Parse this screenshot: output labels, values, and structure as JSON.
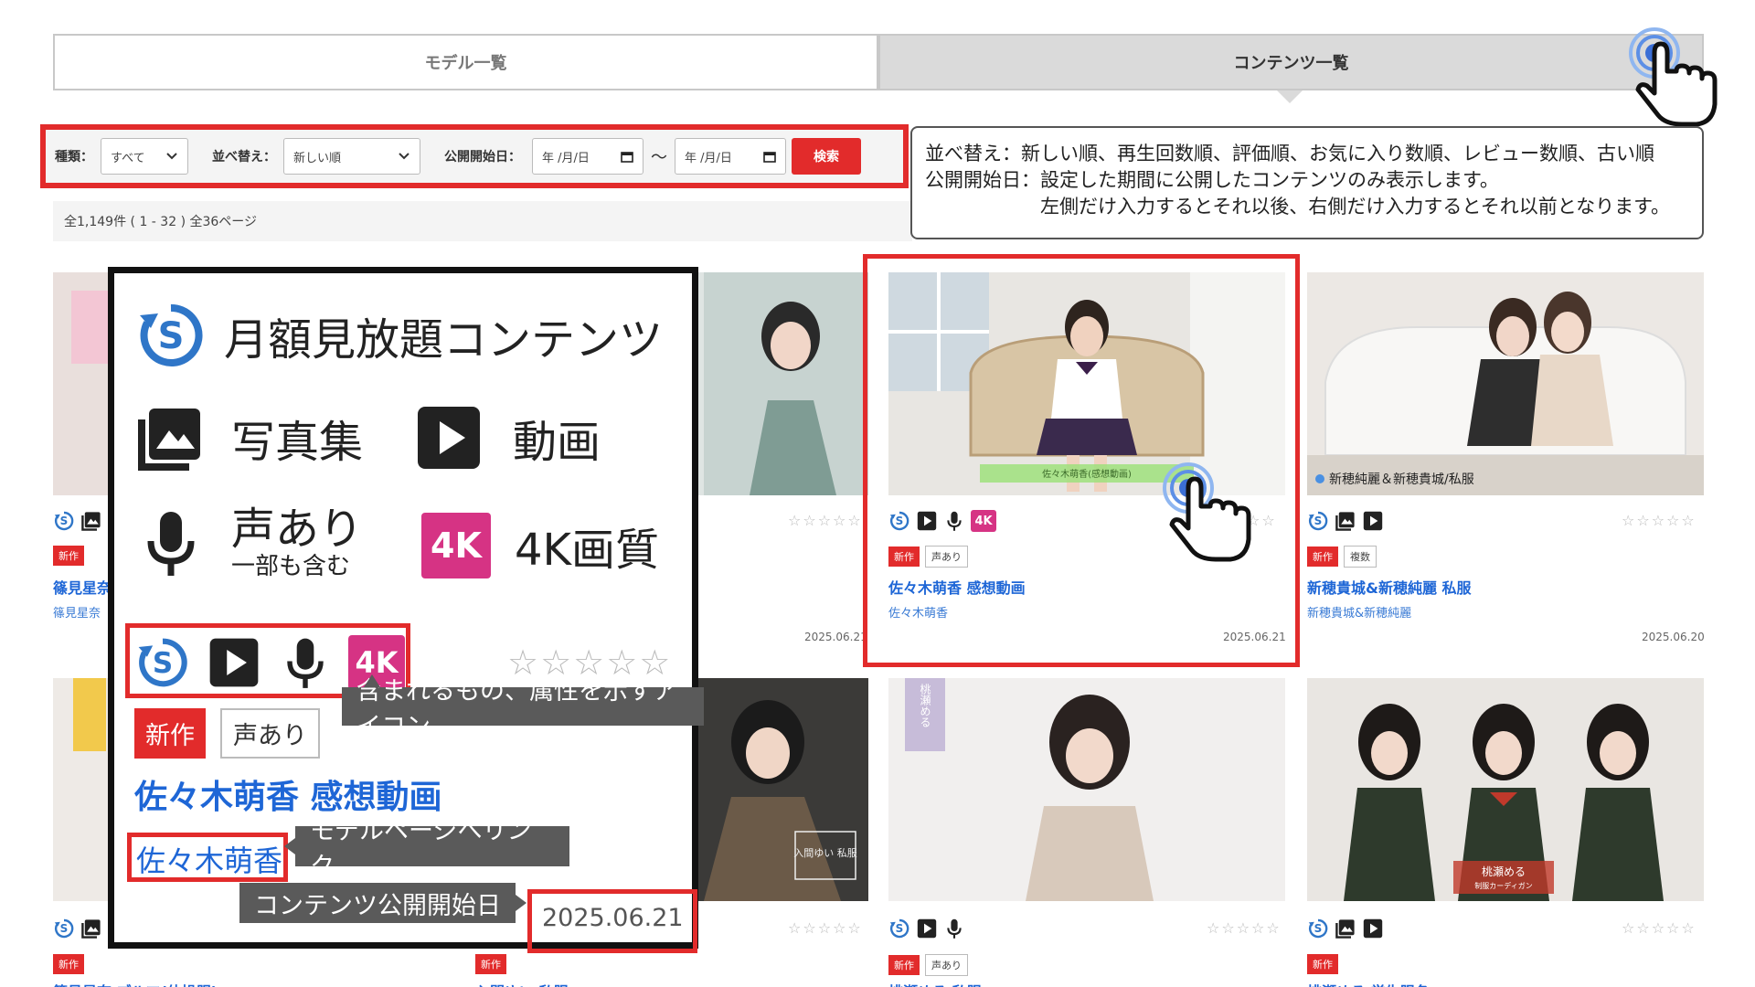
{
  "tabs": {
    "models": "モデル一覧",
    "contents": "コンテンツ一覧"
  },
  "filters": {
    "type_label": "種類：",
    "type_value": "すべて",
    "sort_label": "並べ替え：",
    "sort_value": "新しい順",
    "date_label": "公開開始日：",
    "date_from": "年 /月/日",
    "date_to": "年 /月/日",
    "tilde": "〜",
    "search": "検索"
  },
  "results": {
    "count_text": "全1,149件 ( 1 - 32 )  全36ページ"
  },
  "explanation": {
    "line1": "並べ替え：新しい順、再生回数順、評価順、お気に入り数順、レビュー数順、古い順",
    "line2": "公開開始日：設定した期間に公開したコンテンツのみ表示します。",
    "line3": "左側だけ入力するとそれ以後、右側だけ入力するとそれ以前となります。"
  },
  "legend": {
    "subscription": "月額見放題コンテンツ",
    "photo": "写真集",
    "video": "動画",
    "voice": "声あり",
    "voice_sub": "一部も含む",
    "k4_badge": "4K",
    "k4": "4K画質",
    "new_tag": "新作",
    "voice_tag": "声あり",
    "title": "佐々木萌香 感想動画",
    "model": "佐々木萌香",
    "date": "2025.06.21",
    "stars": "☆☆☆☆☆",
    "callout_icons": "含まれるもの、属性を示すアイコン",
    "callout_model": "モデルページへリンク",
    "callout_date": "コンテンツ公開開始日"
  },
  "cards": [
    {
      "title": "篠見星奈",
      "model": "篠見星奈",
      "tag1": "新作",
      "tag2": "",
      "date": "",
      "stars": ""
    },
    {
      "title": "",
      "model": "",
      "tag1": "",
      "tag2": "",
      "date": "2025.06.21",
      "stars": "☆☆☆☆☆"
    },
    {
      "title": "佐々木萌香 感想動画",
      "model": "佐々木萌香",
      "tag1": "新作",
      "tag2": "声あり",
      "date": "2025.06.21",
      "stars": "☆☆",
      "k4": "4K",
      "caption": "佐々木萌香(感想動画)"
    },
    {
      "title": "新穂貴城&新穂純麗 私服",
      "model": "新穂貴城&新穂純麗",
      "tag1": "新作",
      "tag2": "複数",
      "date": "2025.06.20",
      "stars": "☆☆☆☆☆",
      "caption": "新穂純麗＆新穂貴城/私服"
    },
    {
      "tag1": "新作",
      "title": "篠見星奈 ブルマ(体操服)"
    },
    {
      "tag1": "新作",
      "title": "入間ゆい 私服",
      "stars": "☆☆☆☆☆",
      "caption": "入間ゆい 私服"
    },
    {
      "tag1": "新作",
      "tag2": "声あり",
      "title": "桃瀬める 私服",
      "stars": "☆☆☆☆☆",
      "vertical": "桃瀬める"
    },
    {
      "tag1": "新作",
      "title": "桃瀬める 学生服冬",
      "stars": "☆☆☆☆☆",
      "caption": "桃瀬める",
      "caption2": "制服カーディガン"
    }
  ],
  "colors": {
    "accent_red": "#e22b2b",
    "link_blue": "#1e66d6",
    "badge_4k": "#d63384",
    "icon_blue": "#2f76c8"
  }
}
